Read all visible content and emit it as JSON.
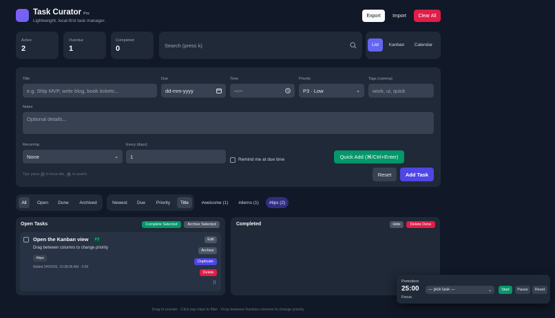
{
  "app": {
    "title": "Task Curator",
    "badge": "Pro",
    "subtitle": "Lightweight, local-first task manager."
  },
  "header_actions": {
    "export": "Export",
    "import": "Import",
    "clear_all": "Clear All"
  },
  "stats": [
    {
      "label": "Active",
      "value": "2"
    },
    {
      "label": "Overdue",
      "value": "1"
    },
    {
      "label": "Completed",
      "value": "0"
    }
  ],
  "search": {
    "placeholder": "Search (press k)"
  },
  "views": {
    "list": "List",
    "kanban": "Kanban",
    "calendar": "Calendar",
    "active": "List"
  },
  "form": {
    "title_label": "Title",
    "title_placeholder": "e.g. Ship MVP, write blog, book tickets...",
    "due_label": "Due",
    "due_value": "dd-mm-yyyy",
    "time_label": "Time",
    "time_value": "--:--",
    "priority_label": "Priority",
    "priority_value": "P3 · Low",
    "tags_label": "Tags (comma)",
    "tags_placeholder": "work, ui, quick",
    "notes_label": "Notes",
    "notes_placeholder": "Optional details...",
    "recurring_label": "Recurring",
    "recurring_value": "None",
    "every_label": "Every (days)",
    "every_value": "1",
    "remind_label": "Remind me at due time",
    "quick_add": "Quick Add (⌘/Ctrl+Enter)",
    "tips_prefix": "Tips: press",
    "tips_key1": "/",
    "tips_mid": "to focus title,",
    "tips_key2": "k",
    "tips_suffix": "to search.",
    "reset": "Reset",
    "add_task": "Add Task"
  },
  "filters": {
    "status": [
      "All",
      "Open",
      "Done",
      "Archived"
    ],
    "status_active": "All",
    "sort": [
      "Newest",
      "Due",
      "Priority",
      "Title"
    ],
    "sort_active": "Title",
    "tags": [
      "#welcome (1)",
      "#demo (1)",
      "#tips (2)"
    ],
    "tag_active": "#tips (2)"
  },
  "open_tasks": {
    "heading": "Open Tasks",
    "complete_selected": "Complete Selected",
    "archive_selected": "Archive Selected",
    "task": {
      "title": "Open the Kanban view",
      "priority": "P3",
      "description": "Drag between columns to change priority",
      "tag": "#tips",
      "added": "Added 9/4/2025, 10:38:06 AM · 0:00",
      "edit": "Edit",
      "archive": "Archive",
      "duplicate": "Duplicate",
      "delete": "Delete"
    }
  },
  "completed": {
    "heading": "Completed",
    "hide": "Hide",
    "delete_done": "Delete Done"
  },
  "pomodoro": {
    "label": "Pomodoro",
    "time": "25:00",
    "mode": "Focus",
    "select_value": "— pick task —",
    "start": "Start",
    "pause": "Pause",
    "reset": "Reset"
  },
  "footer": "Drag to reorder · Click tag chips to filter · Drop between Kanban columns to change priority",
  "colors": {
    "accent": "#6366f1",
    "green": "#10b981",
    "red": "#e11d48",
    "bg": "#111827",
    "card": "#1f2937"
  }
}
